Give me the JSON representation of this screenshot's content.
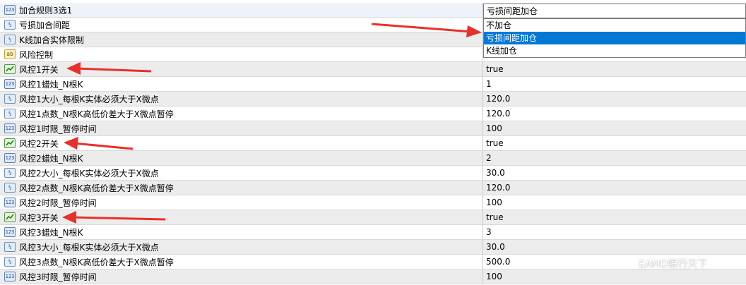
{
  "rows": [
    {
      "name": "加合规则3选1",
      "value": "",
      "icon": "123"
    },
    {
      "name": "亏损加合间距",
      "value": "",
      "icon": "1/2"
    },
    {
      "name": "K线加合实体限制",
      "value": "",
      "icon": "1/2"
    },
    {
      "name": "风险控制",
      "value": "",
      "icon": "ab"
    },
    {
      "name": "风控1开关",
      "value": "true",
      "icon": "bool"
    },
    {
      "name": "风控1蜡烛_N根K",
      "value": "1",
      "icon": "123"
    },
    {
      "name": "风控1大小_每根K实体必须大于X微点",
      "value": "120.0",
      "icon": "1/2"
    },
    {
      "name": "风控1点数_N根K高低价差大于X微点暂停",
      "value": "120.0",
      "icon": "1/2"
    },
    {
      "name": "风控1时限_暂停时间",
      "value": "100",
      "icon": "123"
    },
    {
      "name": "风控2开关",
      "value": "true",
      "icon": "bool"
    },
    {
      "name": "风控2蜡烛_N根K",
      "value": "2",
      "icon": "123"
    },
    {
      "name": "风控2大小_每根K实体必须大于X微点",
      "value": "30.0",
      "icon": "1/2"
    },
    {
      "name": "风控2点数_N根K高低价差大于X微点暂停",
      "value": "120.0",
      "icon": "1/2"
    },
    {
      "name": "风控2时限_暂停时间",
      "value": "100",
      "icon": "123"
    },
    {
      "name": "风控3开关",
      "value": "true",
      "icon": "bool"
    },
    {
      "name": "风控3蜡烛_N根K",
      "value": "3",
      "icon": "123"
    },
    {
      "name": "风控3大小_每根K实体必须大于X微点",
      "value": "30.0",
      "icon": "1/2"
    },
    {
      "name": "风控3点数_N根K高低价差大于X微点暂停",
      "value": "500.0",
      "icon": "1/2"
    },
    {
      "name": "风控3时限_暂停时间",
      "value": "100",
      "icon": "123"
    }
  ],
  "combo": {
    "selected": "亏损间距加仓",
    "options": [
      "不加仓",
      "亏损间距加仓",
      "K线加仓"
    ],
    "highlighted_index": 1
  },
  "watermark": "EAMD银行天下",
  "colors": {
    "arrow": "#e8302a",
    "highlight": "#0078d7",
    "row_alt": "#ececec"
  }
}
